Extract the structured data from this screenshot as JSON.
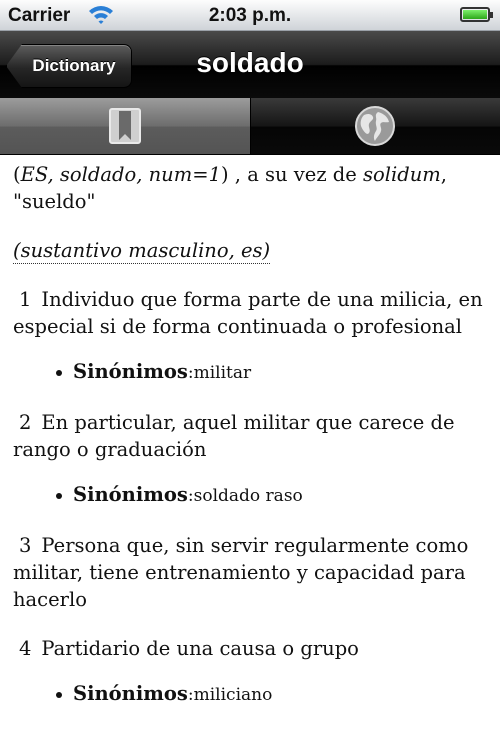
{
  "status_bar": {
    "carrier": "Carrier",
    "time": "2:03 p.m.",
    "battery_level": 1.0
  },
  "nav_bar": {
    "back_label": "Dictionary",
    "title": "soldado"
  },
  "toolbar": {
    "tabs": [
      {
        "icon": "bookmark-icon",
        "selected": true
      },
      {
        "icon": "globe-icon",
        "selected": false
      }
    ]
  },
  "entry": {
    "etymology": {
      "open": "(",
      "source": "ES, soldado, num=1",
      "close": ") , a su vez de ",
      "origin_word": "solidum",
      "comma": ",",
      "meaning": "\"sueldo\""
    },
    "part_of_speech": "(sustantivo masculino, es)",
    "senses": [
      {
        "number": "1",
        "text": "Individuo que forma parte de una milicia, en especial si de forma continuada o profesional",
        "synonyms_label": "Sinónimos",
        "synonyms": ":militar"
      },
      {
        "number": "2",
        "text": "En particular, aquel militar que carece de rango o graduación",
        "synonyms_label": "Sinónimos",
        "synonyms": ":soldado raso"
      },
      {
        "number": "3",
        "text": "Persona que, sin servir regularmente como militar, tiene entrenamiento y capacidad para hacerlo"
      },
      {
        "number": "4",
        "text": "Partidario de una causa o grupo",
        "synonyms_label": "Sinónimos",
        "synonyms": ":miliciano"
      }
    ]
  }
}
